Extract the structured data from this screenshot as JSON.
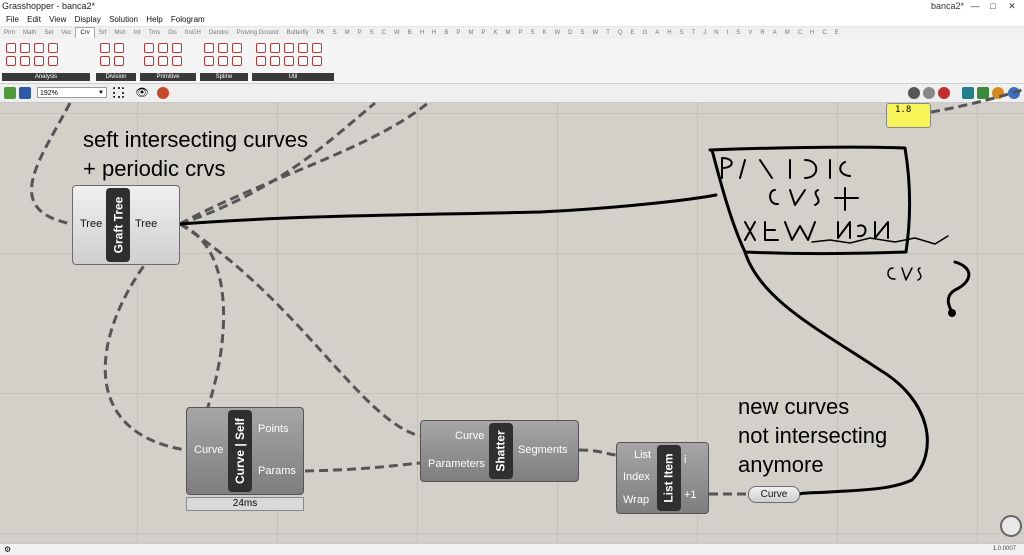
{
  "window": {
    "title": "Grasshopper - banca2*",
    "right_label": "banca2*",
    "minimize": "—",
    "restore": "□",
    "close": "✕"
  },
  "menu": [
    "File",
    "Edit",
    "View",
    "Display",
    "Solution",
    "Help",
    "Fologram"
  ],
  "tabs": [
    "Prm",
    "Math",
    "Set",
    "Vec",
    "Crv",
    "Srf",
    "Msh",
    "Int",
    "Trns",
    "Dis",
    "froGH",
    "Dendro",
    "Proving Ground",
    "Butterfly",
    "PK",
    "S",
    "M",
    "P",
    "S",
    "C",
    "W",
    "B",
    "H",
    "H",
    "B",
    "P",
    "M",
    "P",
    "K",
    "M",
    "P",
    "S",
    "K",
    "W",
    "D",
    "S",
    "W",
    "T",
    "Q",
    "E",
    "G",
    "A",
    "H",
    "S",
    "T",
    "J",
    "N",
    "t",
    "S",
    "V",
    "R",
    "A",
    "M",
    "C",
    "H",
    "C",
    "E"
  ],
  "active_tab_index": 4,
  "ribbon_panels": [
    "Analysis",
    "Division",
    "Primitive",
    "Spline",
    "Util"
  ],
  "toolbar": {
    "zoom": "192%"
  },
  "number_panel": {
    "value": "1.8"
  },
  "components": {
    "graft": {
      "name": "Graft Tree",
      "input": "Tree",
      "output": "Tree"
    },
    "self": {
      "name": "Curve | Self",
      "input": "Curve",
      "out1": "Points",
      "out2": "Params",
      "timing": "24ms"
    },
    "shatter": {
      "name": "Shatter",
      "in1": "Curve",
      "in2": "Parameters",
      "output": "Segments"
    },
    "listitem": {
      "name": "List Item",
      "in1": "List",
      "in2": "Index",
      "in3": "Wrap",
      "out1": "i",
      "out2": "+1"
    },
    "curve_param": {
      "name": "Curve"
    }
  },
  "annotations": {
    "top1": "seft intersecting curves",
    "top2": "+ periodic crvs",
    "bottom1": "new curves",
    "bottom2": "not intersecting",
    "bottom3": "anymore"
  },
  "status": {
    "version": "1.0.0007"
  }
}
